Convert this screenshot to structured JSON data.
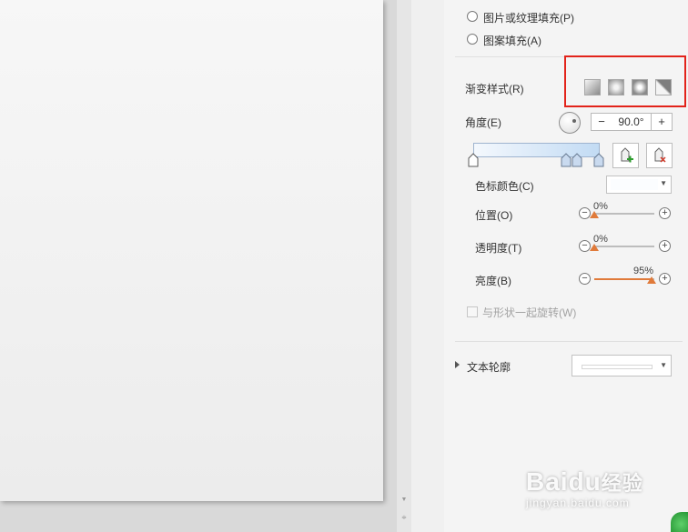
{
  "fill_options": {
    "picture_texture": "图片或纹理填充(P)",
    "pattern": "图案填充(A)"
  },
  "gradient": {
    "style_label": "渐变样式(R)",
    "style_icons": [
      "linear-gradient-icon",
      "radial-gradient-icon",
      "rectangular-gradient-icon",
      "path-gradient-icon"
    ],
    "angle_label": "角度(E)",
    "angle_value": "90.0°",
    "minus": "−",
    "plus": "+",
    "stop_color_label": "色标颜色(C)",
    "position_label": "位置(O)",
    "position_value": "0%",
    "position_level": 0,
    "transparency_label": "透明度(T)",
    "transparency_value": "0%",
    "transparency_level": 0,
    "brightness_label": "亮度(B)",
    "brightness_value": "95%",
    "brightness_level": 95,
    "rotate_with_shape": "与形状一起旋转(W)"
  },
  "text_outline": {
    "label": "文本轮廓"
  },
  "watermark": {
    "brand": "Baidu",
    "brand_cn": "经验",
    "url": "jingyan.baidu.com"
  },
  "colors": {
    "highlight": "#e2231a",
    "slider_accent": "#e07a3a",
    "gradient_start": "#f4f8fd",
    "gradient_end": "#c2dbf4"
  }
}
